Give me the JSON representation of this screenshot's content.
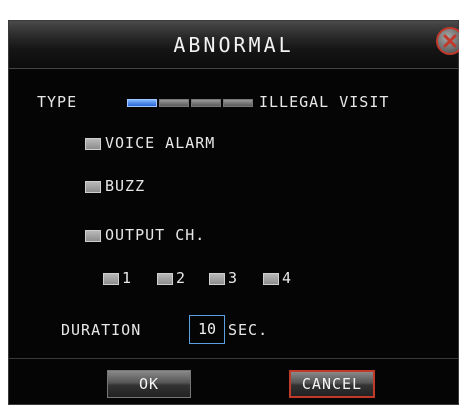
{
  "dialog": {
    "title": "ABNORMAL",
    "close_icon": "close-x-icon"
  },
  "type": {
    "label": "TYPE",
    "options_count_visible": 4,
    "selected_index": 0,
    "value": "ILLEGAL VISIT"
  },
  "options": {
    "voice_alarm": {
      "label": "VOICE ALARM",
      "checked": false
    },
    "buzz": {
      "label": "BUZZ",
      "checked": false
    },
    "output_ch": {
      "label": "OUTPUT CH.",
      "checked": false
    }
  },
  "channels": [
    {
      "label": "1",
      "checked": false
    },
    {
      "label": "2",
      "checked": false
    },
    {
      "label": "3",
      "checked": false
    },
    {
      "label": "4",
      "checked": false
    }
  ],
  "duration": {
    "label": "DURATION",
    "value": "10",
    "unit": "SEC."
  },
  "buttons": {
    "ok": "OK",
    "cancel": "CANCEL"
  },
  "colors": {
    "background": "#050505",
    "accent_blue": "#2a64d8",
    "focus_red": "#c0392b"
  }
}
